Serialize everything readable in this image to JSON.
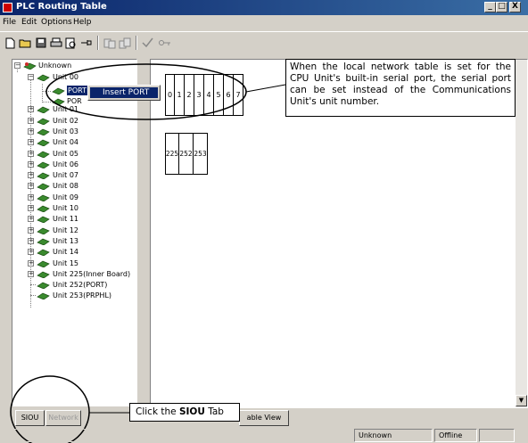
{
  "window": {
    "title": "PLC Routing Table",
    "minimize": "_",
    "maximize": "□",
    "close": "X"
  },
  "menu": [
    "File",
    "Edit",
    "Options",
    "Help"
  ],
  "tree": {
    "root": "Unknown",
    "units": [
      "Unit 00",
      "Unit 01",
      "Unit 02",
      "Unit 03",
      "Unit 04",
      "Unit 05",
      "Unit 06",
      "Unit 07",
      "Unit 08",
      "Unit 09",
      "Unit 10",
      "Unit 11",
      "Unit 12",
      "Unit 13",
      "Unit 14",
      "Unit 15",
      "Unit 225(Inner Board)",
      "Unit 252(PORT)",
      "Unit 253(PRPHL)"
    ],
    "port_items": [
      "PORT",
      "POR"
    ]
  },
  "context_menu": {
    "item": "Insert PORT"
  },
  "table": {
    "row1": [
      "0",
      "1",
      "2",
      "3",
      "4",
      "5",
      "6",
      "7"
    ],
    "row2": [
      "225",
      "252",
      "253"
    ]
  },
  "callouts": {
    "top": "When the local network table is set for the CPU Unit's built-in serial port, the serial port can be set instead of the Communications Unit's unit number.",
    "bottom_prefix": "Click the ",
    "bottom_bold": "SIOU",
    "bottom_suffix": " Tab"
  },
  "tabs": {
    "left": [
      "SIOU",
      "Network"
    ],
    "right": "able View"
  },
  "status": {
    "project": "Unknown",
    "connection": "Offline"
  },
  "colors": {
    "titlebar": "#0a246a",
    "face": "#d4d0c8",
    "unit_icon": "#3a8a2e",
    "selection": "#0a246a"
  }
}
